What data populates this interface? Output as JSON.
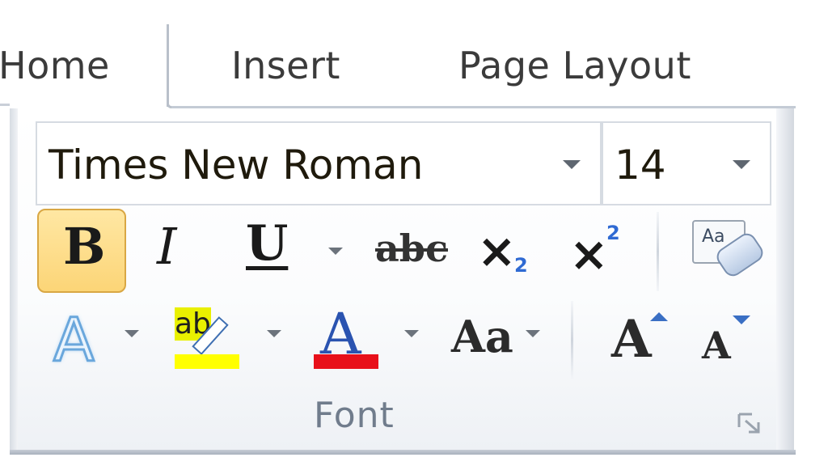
{
  "tabs": [
    {
      "label": "Home",
      "active": true
    },
    {
      "label": "Insert",
      "active": false
    },
    {
      "label": "Page Layout",
      "active": false
    }
  ],
  "font_group": {
    "font_family": "Times New Roman",
    "font_size": "14",
    "label": "Font",
    "row1": {
      "bold": {
        "glyph": "B",
        "active": true
      },
      "italic": {
        "glyph": "I"
      },
      "underline": {
        "glyph": "U"
      },
      "strikethrough": {
        "glyph": "abc"
      },
      "subscript": {
        "glyph": "×",
        "sub": "2"
      },
      "superscript": {
        "glyph": "×",
        "sup": "2"
      },
      "clear_formatting": {
        "glyph": "Aa",
        "icon": "clear-formatting-icon"
      }
    },
    "row2": {
      "text_effects": {
        "glyph": "A",
        "icon": "text-effects-icon"
      },
      "highlight": {
        "glyph": "ab",
        "icon": "highlighter-icon",
        "color": "#ffff00"
      },
      "font_color": {
        "glyph": "A",
        "icon": "font-color-icon",
        "color": "#e8101a"
      },
      "change_case": {
        "glyph": "Aa"
      },
      "grow_font": {
        "glyph": "A",
        "icon": "grow-font-icon"
      },
      "shrink_font": {
        "glyph": "A",
        "icon": "shrink-font-icon"
      }
    }
  },
  "colors": {
    "bold_active_bg": "#fcd577",
    "highlight_bar": "#ffff00",
    "font_color_bar": "#e8101a",
    "accent_arrow": "#3a6fc4"
  }
}
